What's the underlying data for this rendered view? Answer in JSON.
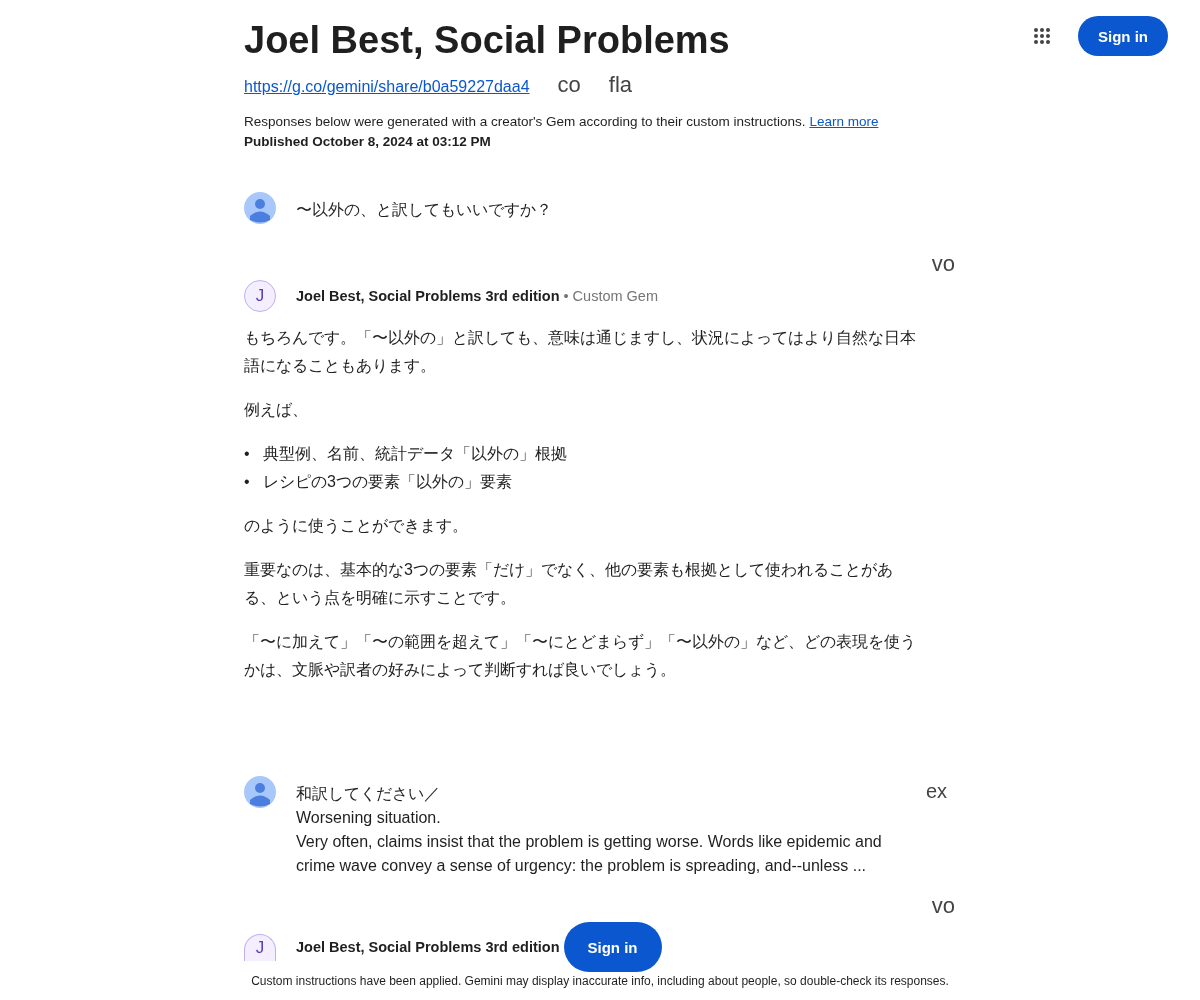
{
  "top_bar": {
    "sign_in": "Sign in"
  },
  "header": {
    "title": "Joel Best, Social Problems",
    "share_link": "https://g.co/gemini/share/b0a59227daa4",
    "fragments": [
      "co",
      "fla"
    ],
    "notice": "Responses below were generated with a creator's Gem according to their custom instructions.",
    "learn_more": "Learn more",
    "published": "Published October 8, 2024 at 03:12 PM"
  },
  "conversation": [
    {
      "kind": "user",
      "lines": [
        "〜以外の、と訳してもいいですか？"
      ]
    },
    {
      "kind": "model",
      "side_fragment": "vo",
      "avatar_letter": "J",
      "name": "Joel Best, Social Problems 3rd edition",
      "badge": "• Custom Gem",
      "blocks": [
        {
          "kind": "p",
          "text": "もちろんです。「〜以外の」と訳しても、意味は通じますし、状況によってはより自然な日本語になることもあります。"
        },
        {
          "kind": "p",
          "text": "例えば、"
        },
        {
          "kind": "list",
          "items": [
            {
              "bullet": "•",
              "text": "典型例、名前、統計データ「以外の」根拠"
            },
            {
              "bullet": "•",
              "text": "レシピの3つの要素「以外の」要素"
            }
          ]
        },
        {
          "kind": "p",
          "text": "のように使うことができます。"
        },
        {
          "kind": "p",
          "text": "重要なのは、基本的な3つの要素「だけ」でなく、他の要素も根拠として使われることがある、という点を明確に示すことです。"
        },
        {
          "kind": "p",
          "text": "「〜に加えて」「〜の範囲を超えて」「〜にとどまらず」「〜以外の」など、どの表現を使うかは、文脈や訳者の好みによって判断すれば良いでしょう。"
        }
      ]
    },
    {
      "kind": "user",
      "side_fragment": "ex",
      "lines": [
        "和訳してください／",
        "Worsening situation.",
        "Very often, claims insist that the problem is getting worse. Words like epidemic and crime wave convey a sense of urgency: the problem is spreading, and--unless ..."
      ]
    },
    {
      "kind": "model",
      "side_fragment": "vo",
      "avatar_letter": "J",
      "name": "Joel Best, Social Problems 3rd edition",
      "clipped": true
    }
  ],
  "floating_sign_in": "Sign in",
  "footer": "Custom instructions have been applied. Gemini may display inaccurate info, including about people, so double-check its responses."
}
